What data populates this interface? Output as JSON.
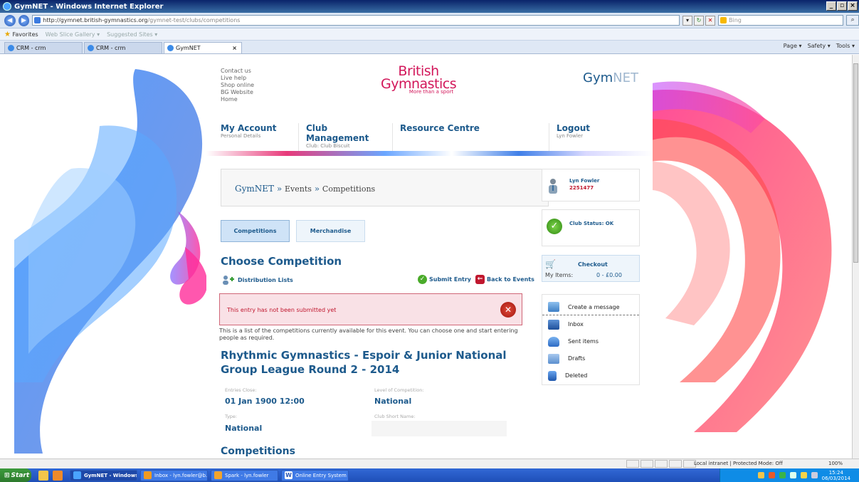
{
  "browser": {
    "title": "GymNET - Windows Internet Explorer",
    "url_host": "http://gymnet.british-gymnastics.org",
    "url_path": "/gymnet-test/clubs/competitions",
    "search_placeholder": "Bing",
    "favorites_label": "Favorites",
    "fav_links": [
      "Web Slice Gallery ▾",
      "Suggested Sites ▾"
    ],
    "tabs": [
      {
        "label": "CRM - crm",
        "active": false
      },
      {
        "label": "CRM - crm",
        "active": false
      },
      {
        "label": "GymNET",
        "active": true
      }
    ],
    "commands": [
      "Page ▾",
      "Safety ▾",
      "Tools ▾"
    ],
    "status_zone": "Local intranet | Protected Mode: Off",
    "zoom": "100%"
  },
  "site": {
    "top_links": [
      "Contact us",
      "Live help",
      "Shop online",
      "BG Website",
      "Home"
    ],
    "logo_line1": "British",
    "logo_line2": "Gymnastics",
    "logo_tagline": "More than a sport",
    "brand_gym": "Gym",
    "brand_net": "NET",
    "nav": [
      {
        "label": "My Account",
        "sub": "Personal Details"
      },
      {
        "label": "Club Management",
        "sub": "Club: Club Biscuit"
      },
      {
        "label": "Resource Centre",
        "sub": ""
      },
      {
        "label": "Logout",
        "sub": "Lyn Fowler"
      }
    ]
  },
  "breadcrumb": {
    "root": "GymNET",
    "sep": "»",
    "level1": "Events",
    "current": "Competitions"
  },
  "subtabs": [
    {
      "label": "Competitions",
      "active": true
    },
    {
      "label": "Merchandise",
      "active": false
    }
  ],
  "main": {
    "heading": "Choose Competition",
    "distribution_lists": "Distribution Lists",
    "submit_entry": "Submit Entry",
    "back_to_events": "Back to Events",
    "alert": "This entry has not been submitted yet",
    "description": "This is a list of the competitions currently available for this event. You can choose one and start entering people as required.",
    "competition_title": "Rhythmic Gymnastics - Espoir & Junior National Group League Round 2 - 2014",
    "fields": {
      "entries_close_label": "Entries Close:",
      "entries_close_value": "01 Jan 1900 12:00",
      "level_label": "Level of Competition:",
      "level_value": "National",
      "type_label": "Type:",
      "type_value": "National",
      "club_short_label": "Club Short Name:"
    },
    "competitions_heading": "Competitions"
  },
  "sidebar": {
    "user_name": "Lyn Fowler",
    "user_id": "2251477",
    "club_status": "Club Status: OK",
    "checkout_label": "Checkout",
    "my_items_label": "My Items:",
    "my_items_value": "0  -  £0.00",
    "messages": [
      "Create a message",
      "Inbox",
      "Sent items",
      "Drafts",
      "Deleted"
    ]
  },
  "taskbar": {
    "start": "Start",
    "tasks": [
      {
        "label": "GymNET - Windows...",
        "active": true
      },
      {
        "label": "Inbox - lyn.fowler@b...",
        "active": false
      },
      {
        "label": "Spark - lyn.fowler",
        "active": false
      },
      {
        "label": "Online Entry System ...",
        "active": false
      }
    ],
    "time": "15:24",
    "date": "06/03/2014"
  },
  "colors": {
    "brand_blue": "#1d5a8c",
    "brand_pink": "#d2175a",
    "alert_red": "#c0172e"
  }
}
